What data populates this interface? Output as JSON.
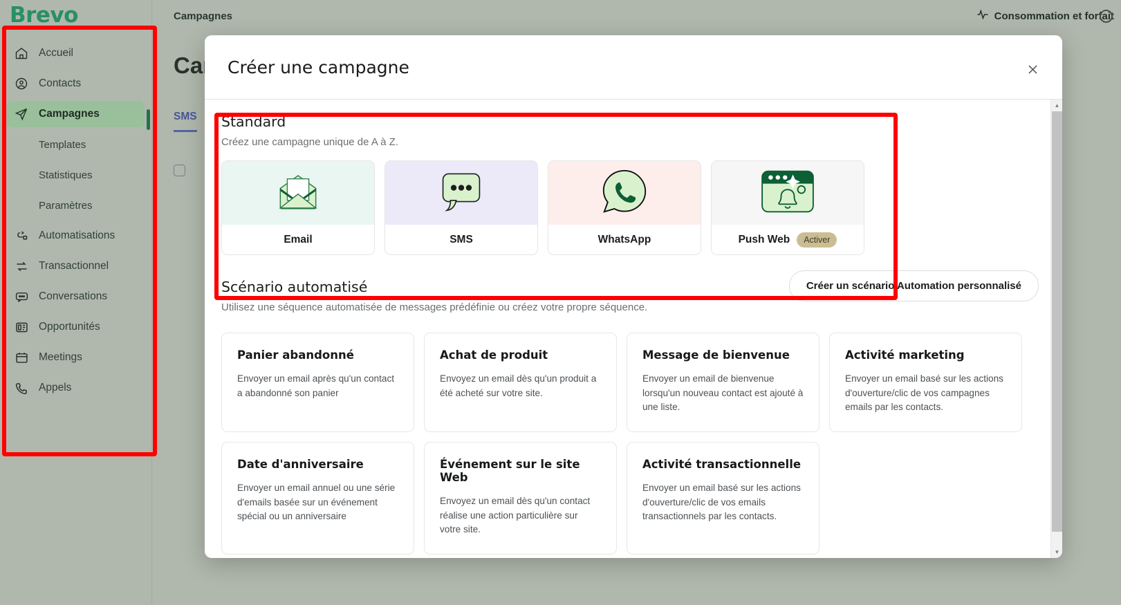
{
  "brand": {
    "name": "Brevo"
  },
  "sidebar": {
    "items": [
      {
        "label": "Accueil",
        "icon": "home-icon",
        "active": false,
        "sub": false
      },
      {
        "label": "Contacts",
        "icon": "user-circle-icon",
        "active": false,
        "sub": false
      },
      {
        "label": "Campagnes",
        "icon": "send-icon",
        "active": true,
        "sub": false
      },
      {
        "label": "Templates",
        "icon": "",
        "active": false,
        "sub": true
      },
      {
        "label": "Statistiques",
        "icon": "",
        "active": false,
        "sub": true
      },
      {
        "label": "Paramètres",
        "icon": "",
        "active": false,
        "sub": true
      },
      {
        "label": "Automatisations",
        "icon": "automation-icon",
        "active": false,
        "sub": false
      },
      {
        "label": "Transactionnel",
        "icon": "exchange-icon",
        "active": false,
        "sub": false
      },
      {
        "label": "Conversations",
        "icon": "chat-bubble-icon",
        "active": false,
        "sub": false
      },
      {
        "label": "Opportunités",
        "icon": "deal-card-icon",
        "active": false,
        "sub": false
      },
      {
        "label": "Meetings",
        "icon": "calendar-icon",
        "active": false,
        "sub": false
      },
      {
        "label": "Appels",
        "icon": "phone-icon",
        "active": false,
        "sub": false
      }
    ]
  },
  "topbar": {
    "breadcrumb": "Campagnes",
    "usage_label": "Consommation et forfait",
    "usage_icon": "pulse-icon"
  },
  "page": {
    "title": "Campagnes",
    "tabs": [
      {
        "label": "SMS",
        "selected": true
      }
    ]
  },
  "modal": {
    "title": "Créer une campagne",
    "close_icon": "close-icon",
    "standard": {
      "heading": "Standard",
      "subheading": "Créez une campagne unique de A à Z.",
      "cards": [
        {
          "label": "Email",
          "icon": "envelope-icon",
          "badge": ""
        },
        {
          "label": "SMS",
          "icon": "speech-bubble-dots-icon",
          "badge": ""
        },
        {
          "label": "WhatsApp",
          "icon": "whatsapp-icon",
          "badge": ""
        },
        {
          "label": "Push Web",
          "icon": "push-notification-icon",
          "badge": "Activer"
        }
      ]
    },
    "scenario": {
      "heading": "Scénario automatisé",
      "subheading": "Utilisez une séquence automatisée de messages prédéfinie ou créez votre propre séquence.",
      "custom_button": "Créer un scénario Automation personnalisé",
      "cards": [
        {
          "name": "Panier abandonné",
          "desc": "Envoyer un email après qu'un contact a abandonné son panier"
        },
        {
          "name": "Achat de produit",
          "desc": "Envoyez un email dès qu'un produit a été acheté sur votre site."
        },
        {
          "name": "Message de bienvenue",
          "desc": "Envoyer un email de bienvenue lorsqu'un nouveau contact est ajouté à une liste."
        },
        {
          "name": "Activité marketing",
          "desc": "Envoyer un email basé sur les actions d'ouverture/clic de vos campagnes emails par les contacts."
        },
        {
          "name": "Date d'anniversaire",
          "desc": "Envoyer un email annuel ou une série d'emails basée sur un événement spécial ou un anniversaire"
        },
        {
          "name": "Événement sur le site Web",
          "desc": "Envoyez un email dès qu'un contact réalise une action particulière sur votre site."
        },
        {
          "name": "Activité transactionnelle",
          "desc": "Envoyer un email basé sur les actions d'ouverture/clic de vos emails transactionnels par les contacts."
        }
      ]
    }
  },
  "colors": {
    "brand_green": "#2a9d6e",
    "sidebar_bg": "#c3cbc0",
    "active_item_bg": "#a9d3ab",
    "annotation_red": "#ff0000",
    "badge_bg": "#cbbd93",
    "tab_blue": "#4a5ca8"
  }
}
